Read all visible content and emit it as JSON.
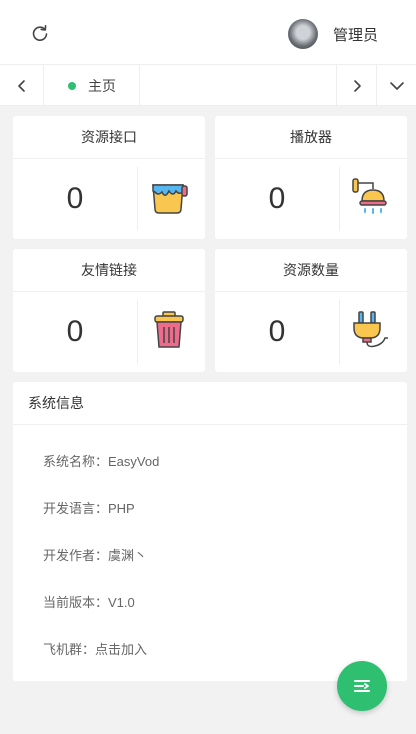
{
  "header": {
    "refresh_icon": "refresh-icon",
    "avatar_icon": "user-avatar",
    "username": "管理员"
  },
  "tabs": {
    "prev_icon": "chevron-left-icon",
    "next_icon": "chevron-right-icon",
    "more_icon": "chevron-down-icon",
    "active_dot_color": "#2fbf71",
    "items": [
      {
        "label": "主页"
      }
    ]
  },
  "stats": [
    {
      "title": "资源接口",
      "count": "0",
      "icon": "paint-bucket-icon"
    },
    {
      "title": "播放器",
      "count": "0",
      "icon": "shower-icon"
    },
    {
      "title": "友情链接",
      "count": "0",
      "icon": "trash-bin-icon"
    },
    {
      "title": "资源数量",
      "count": "0",
      "icon": "power-plug-icon"
    }
  ],
  "system_info": {
    "title": "系统信息",
    "rows": [
      {
        "text": "系统名称：EasyVod"
      },
      {
        "text": "开发语言：PHP"
      },
      {
        "text": "开发作者：虞渊丶"
      },
      {
        "text": "当前版本：V1.0"
      },
      {
        "text": "飞机群：点击加入"
      }
    ]
  },
  "fab": {
    "icon": "menu-toggle-icon",
    "color": "#2fbf71"
  }
}
